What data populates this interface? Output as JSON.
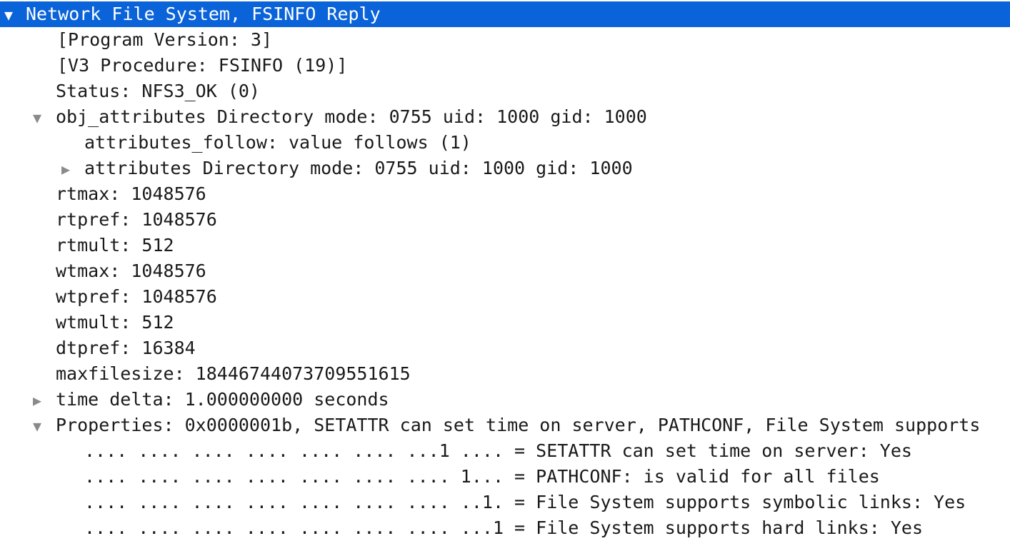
{
  "tree": {
    "root": {
      "toggle": "▼",
      "label": "Network File System, FSINFO Reply"
    },
    "program_version": "[Program Version: 3]",
    "v3_procedure": "[V3 Procedure: FSINFO (19)]",
    "status": "Status: NFS3_OK (0)",
    "obj_attributes": {
      "toggle": "▼",
      "label": "obj_attributes  Directory mode: 0755 uid: 1000 gid: 1000",
      "attributes_follow": "attributes_follow: value follows (1)",
      "attributes": {
        "toggle": "▶",
        "label": "attributes  Directory mode: 0755 uid: 1000 gid: 1000"
      }
    },
    "rtmax": "rtmax: 1048576",
    "rtpref": "rtpref: 1048576",
    "rtmult": "rtmult: 512",
    "wtmax": "wtmax: 1048576",
    "wtpref": "wtpref: 1048576",
    "wtmult": "wtmult: 512",
    "dtpref": "dtpref: 16384",
    "maxfilesize": "maxfilesize: 18446744073709551615",
    "time_delta": {
      "toggle": "▶",
      "label": "time delta: 1.000000000 seconds"
    },
    "properties": {
      "toggle": "▼",
      "label": "Properties: 0x0000001b, SETATTR can set time on server, PATHCONF, File System supports",
      "bits": [
        ".... .... .... .... .... .... ...1 .... = SETATTR can set time on server: Yes",
        ".... .... .... .... .... .... .... 1... = PATHCONF: is valid for all files",
        ".... .... .... .... .... .... .... ..1. = File System supports symbolic links: Yes",
        ".... .... .... .... .... .... .... ...1 = File System supports hard links: Yes"
      ]
    }
  },
  "colors": {
    "selection": "#0a63d8",
    "text": "#1a1a1a",
    "toggle": "#8a8a8a"
  }
}
